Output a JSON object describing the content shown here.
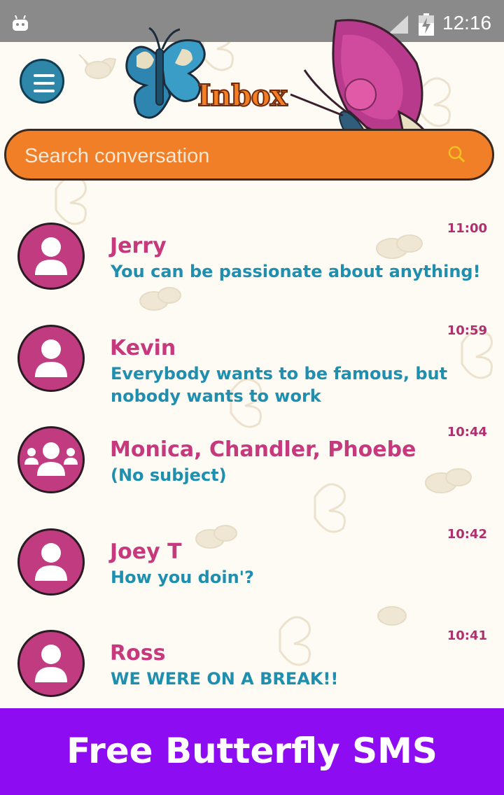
{
  "status_bar": {
    "time": "12:16"
  },
  "header": {
    "title": "Inbox",
    "menu_icon": "hamburger-menu-icon"
  },
  "search": {
    "placeholder": "Search conversation",
    "icon": "search-icon"
  },
  "conversations": [
    {
      "name": "Jerry",
      "message": " You can be passionate about anything!",
      "time": "11:00",
      "avatar": "single-person-icon"
    },
    {
      "name": "Kevin",
      "message": " Everybody wants to be famous, but nobody wants to work",
      "time": "10:59",
      "avatar": "single-person-icon"
    },
    {
      "name": "Monica, Chandler, Phoebe",
      "message": "(No subject)",
      "time": "10:44",
      "avatar": "group-icon"
    },
    {
      "name": "Joey T",
      "message": "How you doin'?",
      "time": "10:42",
      "avatar": "single-person-icon"
    },
    {
      "name": "Ross",
      "message": "WE WERE ON A BREAK!!",
      "time": "10:41",
      "avatar": "single-person-icon"
    }
  ],
  "banner": {
    "text": "Free Butterfly SMS"
  },
  "colors": {
    "accent_orange": "#f07f27",
    "name_pink": "#c63a7d",
    "message_teal": "#1f8fb0",
    "banner_purple": "#8e0cf2"
  }
}
